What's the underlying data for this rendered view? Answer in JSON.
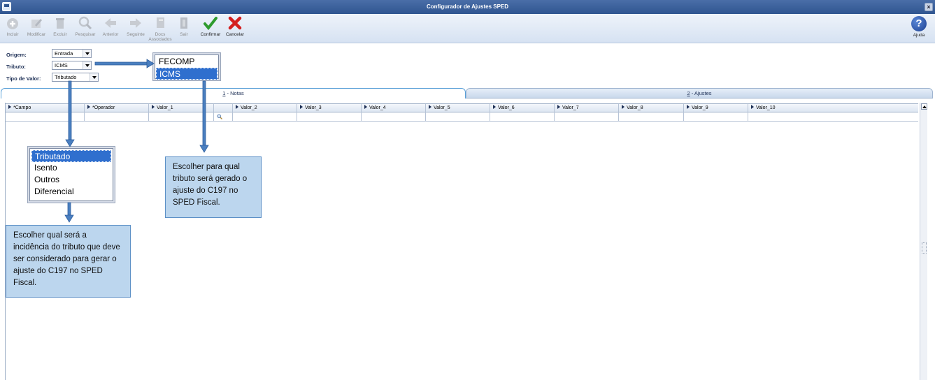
{
  "window": {
    "title": "Configurador de Ajustes SPED"
  },
  "toolbar": {
    "buttons": [
      {
        "label": "Incluir",
        "icon": "add-icon"
      },
      {
        "label": "Modificar",
        "icon": "edit-icon"
      },
      {
        "label": "Excluir",
        "icon": "trash-icon"
      },
      {
        "label": "Pesquisar",
        "icon": "search-icon"
      },
      {
        "label": "Anterior",
        "icon": "arrow-left-icon"
      },
      {
        "label": "Seguinte",
        "icon": "arrow-right-icon"
      },
      {
        "label": "Docs Associados",
        "icon": "documents-icon"
      },
      {
        "label": "Sair",
        "icon": "exit-icon"
      },
      {
        "label": "Confirmar",
        "icon": "check-icon"
      },
      {
        "label": "Cancelar",
        "icon": "cancel-icon"
      }
    ],
    "help_label": "Ajuda",
    "help_glyph": "?"
  },
  "form": {
    "origem": {
      "label": "Origem:",
      "value": "Entrada"
    },
    "tributo": {
      "label": "Tributo:",
      "value": "ICMS"
    },
    "tipo_valor": {
      "label": "Tipo de Valor:",
      "value": "Tributado"
    }
  },
  "tributo_popup": {
    "options": [
      "FECOMP",
      "ICMS"
    ],
    "selected": "ICMS"
  },
  "tipo_popup": {
    "options": [
      "Tributado",
      "Isento",
      "Outros",
      "Diferencial"
    ],
    "selected": "Tributado"
  },
  "tabs": [
    {
      "num": "1",
      "label": " - Notas",
      "active": true
    },
    {
      "num": "2",
      "label": " - Ajustes",
      "active": false
    }
  ],
  "grid": {
    "columns": [
      "*Campo",
      "*Operador",
      "Valor_1",
      "",
      "Valor_2",
      "Valor_3",
      "Valor_4",
      "Valor_5",
      "Valor_6",
      "Valor_7",
      "Valor_8",
      "Valor_9",
      "Valor_10"
    ]
  },
  "callouts": {
    "tributo": "Escolher para qual tributo será gerado o ajuste do C197 no SPED Fiscal.",
    "tipo": "Escolher qual será a incidência do tributo que deve ser considerado para gerar o ajuste do C197 no SPED Fiscal."
  },
  "colors": {
    "titlebar": "#2f5590",
    "callout_bg": "#bcd6ee",
    "arrow": "#4a7fc0",
    "selection": "#2f6fce"
  }
}
